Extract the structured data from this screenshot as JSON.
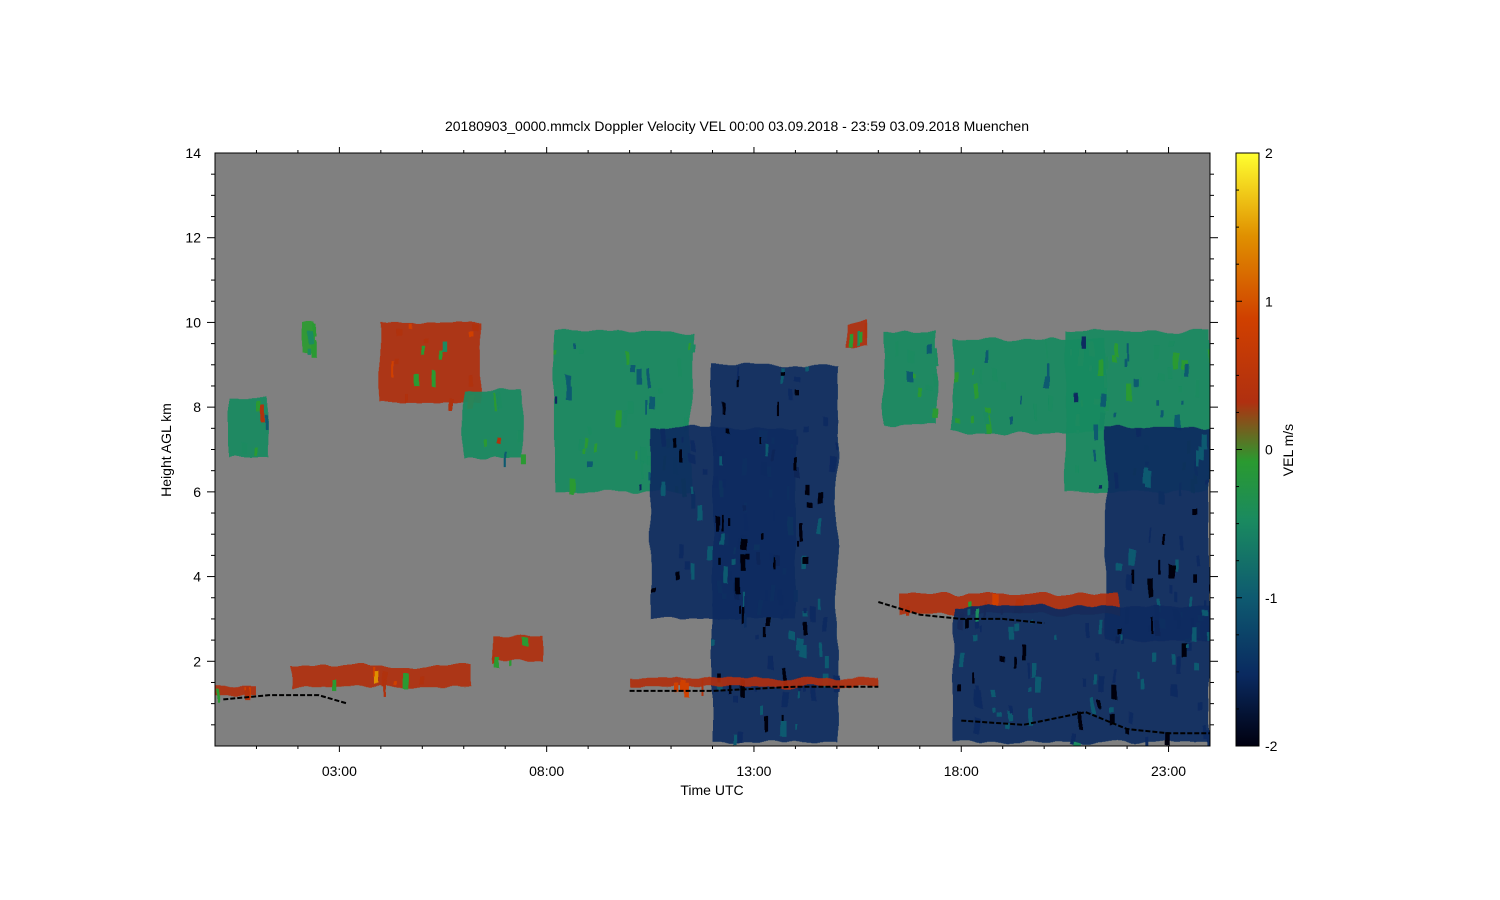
{
  "chart_data": {
    "type": "heatmap",
    "title": "20180903_0000.mmclx Doppler Velocity VEL   00:00 03.09.2018 - 23:59 03.09.2018 Muenchen",
    "xlabel": "Time UTC",
    "ylabel": "Height AGL km",
    "colorbar_label": "VEL m/s",
    "xlim": [
      0,
      24
    ],
    "ylim": [
      0,
      14
    ],
    "clim": [
      -2,
      2
    ],
    "x_ticks": [
      {
        "value": 3,
        "label": "03:00"
      },
      {
        "value": 8,
        "label": "08:00"
      },
      {
        "value": 13,
        "label": "13:00"
      },
      {
        "value": 18,
        "label": "18:00"
      },
      {
        "value": 23,
        "label": "23:00"
      }
    ],
    "y_ticks": [
      {
        "value": 2,
        "label": "2"
      },
      {
        "value": 4,
        "label": "4"
      },
      {
        "value": 6,
        "label": "6"
      },
      {
        "value": 8,
        "label": "8"
      },
      {
        "value": 10,
        "label": "10"
      },
      {
        "value": 12,
        "label": "12"
      },
      {
        "value": 14,
        "label": "14"
      }
    ],
    "colorbar_ticks": [
      {
        "value": 2,
        "label": "2"
      },
      {
        "value": 1,
        "label": "1"
      },
      {
        "value": 0,
        "label": "0"
      },
      {
        "value": -1,
        "label": "-1"
      },
      {
        "value": -2,
        "label": "-2"
      }
    ],
    "background_color": "#808080",
    "colormap": [
      "#000010",
      "#0a2a60",
      "#0e5a70",
      "#1a8a60",
      "#2a9a30",
      "#b03010",
      "#d04000",
      "#e09000",
      "#ffff30"
    ],
    "echo_regions": [
      {
        "t": [
          0.35,
          1.3
        ],
        "h": [
          6.8,
          8.2
        ],
        "vel": -0.3
      },
      {
        "t": [
          2.1,
          2.4
        ],
        "h": [
          9.3,
          10.0
        ],
        "vel": -0.2
      },
      {
        "t": [
          4.0,
          6.4
        ],
        "h": [
          8.1,
          10.0
        ],
        "vel": 0.4
      },
      {
        "t": [
          6.0,
          7.4
        ],
        "h": [
          6.8,
          8.4
        ],
        "vel": -0.3
      },
      {
        "t": [
          8.2,
          11.5
        ],
        "h": [
          6.0,
          9.8
        ],
        "vel": -0.6
      },
      {
        "t": [
          10.5,
          14.0
        ],
        "h": [
          3.0,
          7.5
        ],
        "vel": -1.3
      },
      {
        "t": [
          12.0,
          15.0
        ],
        "h": [
          0.1,
          9.0
        ],
        "vel": -1.6
      },
      {
        "t": [
          15.2,
          15.8
        ],
        "h": [
          9.4,
          10.0
        ],
        "vel": 0.3
      },
      {
        "t": [
          16.1,
          17.4
        ],
        "h": [
          7.6,
          9.8
        ],
        "vel": -0.3
      },
      {
        "t": [
          17.8,
          21.5
        ],
        "h": [
          7.4,
          9.6
        ],
        "vel": -0.5
      },
      {
        "t": [
          20.5,
          24.0
        ],
        "h": [
          6.0,
          9.8
        ],
        "vel": -0.7
      },
      {
        "t": [
          21.5,
          24.0
        ],
        "h": [
          2.5,
          7.5
        ],
        "vel": -1.4
      },
      {
        "t": [
          16.5,
          21.8
        ],
        "h": [
          3.1,
          3.6
        ],
        "vel": 0.6
      },
      {
        "t": [
          17.8,
          24.0
        ],
        "h": [
          0.1,
          3.3
        ],
        "vel": -1.4
      },
      {
        "t": [
          0.0,
          1.0
        ],
        "h": [
          1.2,
          1.4
        ],
        "vel": 0.5
      },
      {
        "t": [
          1.8,
          6.2
        ],
        "h": [
          1.4,
          1.9
        ],
        "vel": 0.6
      },
      {
        "t": [
          6.7,
          7.9
        ],
        "h": [
          2.0,
          2.6
        ],
        "vel": 0.4
      },
      {
        "t": [
          10.0,
          16.0
        ],
        "h": [
          1.4,
          1.6
        ],
        "vel": 0.5
      }
    ],
    "cloud_base_lines": [
      {
        "t": [
          0.2,
          1.3,
          2.5,
          3.2
        ],
        "h": [
          1.1,
          1.2,
          1.2,
          1.0
        ]
      },
      {
        "t": [
          10.0,
          12.0,
          14.0,
          16.0
        ],
        "h": [
          1.3,
          1.3,
          1.4,
          1.4
        ]
      },
      {
        "t": [
          16.0,
          17.0,
          18.0,
          19.0,
          20.0
        ],
        "h": [
          3.4,
          3.1,
          3.0,
          3.0,
          2.9
        ]
      },
      {
        "t": [
          18.0,
          19.5,
          21.0,
          22.0,
          23.0,
          24.0
        ],
        "h": [
          0.6,
          0.5,
          0.8,
          0.4,
          0.3,
          0.3
        ]
      }
    ]
  }
}
